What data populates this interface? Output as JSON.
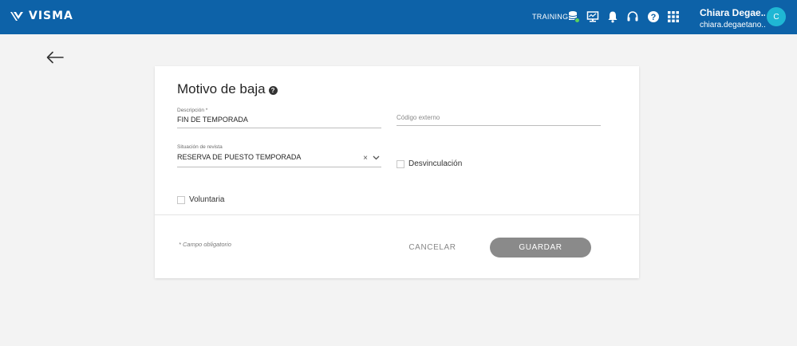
{
  "header": {
    "logo_text": "VISMA",
    "environment": "TRAINING",
    "icons": [
      "database-icon",
      "monitor-icon",
      "bell-icon",
      "headset-icon",
      "help-icon",
      "apps-grid-icon"
    ],
    "user": {
      "name": "Chiara Degae...",
      "email": "chiara.degaetano...",
      "avatar_initial": "C"
    },
    "colors": {
      "bar": "#0d62a8",
      "avatar": "#1fb7d4",
      "status_green": "#5bd15b"
    }
  },
  "form": {
    "title": "Motivo de baja",
    "help_glyph": "?",
    "fields": {
      "descripcion": {
        "label": "Descripción *",
        "value": "FIN DE TEMPORADA"
      },
      "codigo_externo": {
        "placeholder": "Código externo",
        "value": ""
      },
      "situacion": {
        "label": "Situación de revista",
        "value": "RESERVA DE PUESTO TEMPORADA",
        "clear_glyph": "×"
      }
    },
    "checkboxes": {
      "desvinculacion": {
        "label": "Desvinculación",
        "checked": false
      },
      "voluntaria": {
        "label": "Voluntaria",
        "checked": false
      }
    },
    "required_note": "* Campo obligatorio",
    "buttons": {
      "cancel": "CANCELAR",
      "save": "GUARDAR"
    }
  }
}
